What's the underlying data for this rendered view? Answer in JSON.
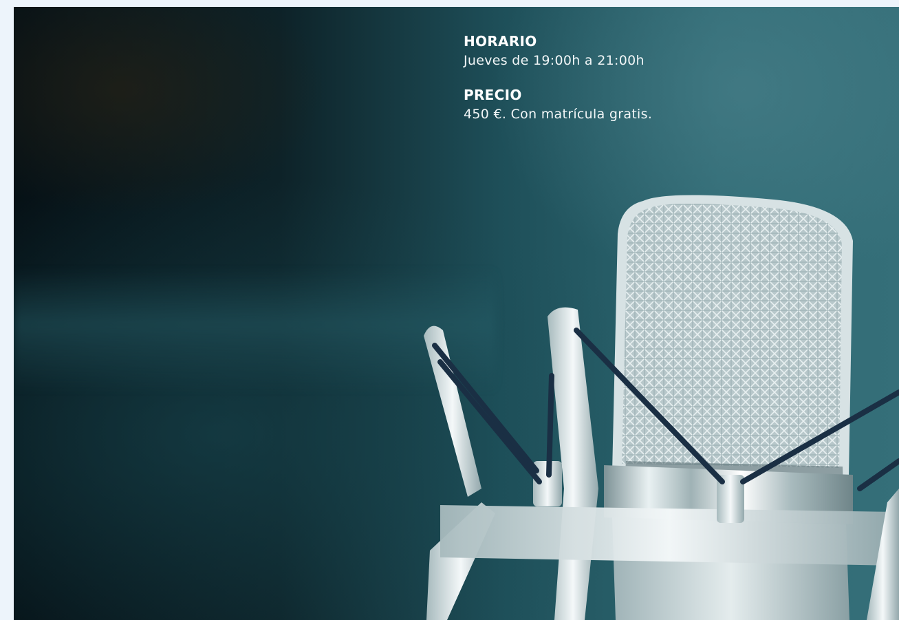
{
  "schedule": {
    "label": "HORARIO",
    "value": "Jueves de 19:00h a 21:00h"
  },
  "price": {
    "label": "PRECIO",
    "value": "450 €. Con matrícula gratis."
  },
  "colors": {
    "page_background": "#edf4fb",
    "hero_dark": "#061116",
    "hero_teal": "#356f79",
    "text": "#ffffff"
  },
  "image": {
    "subject": "microphone-icon"
  }
}
